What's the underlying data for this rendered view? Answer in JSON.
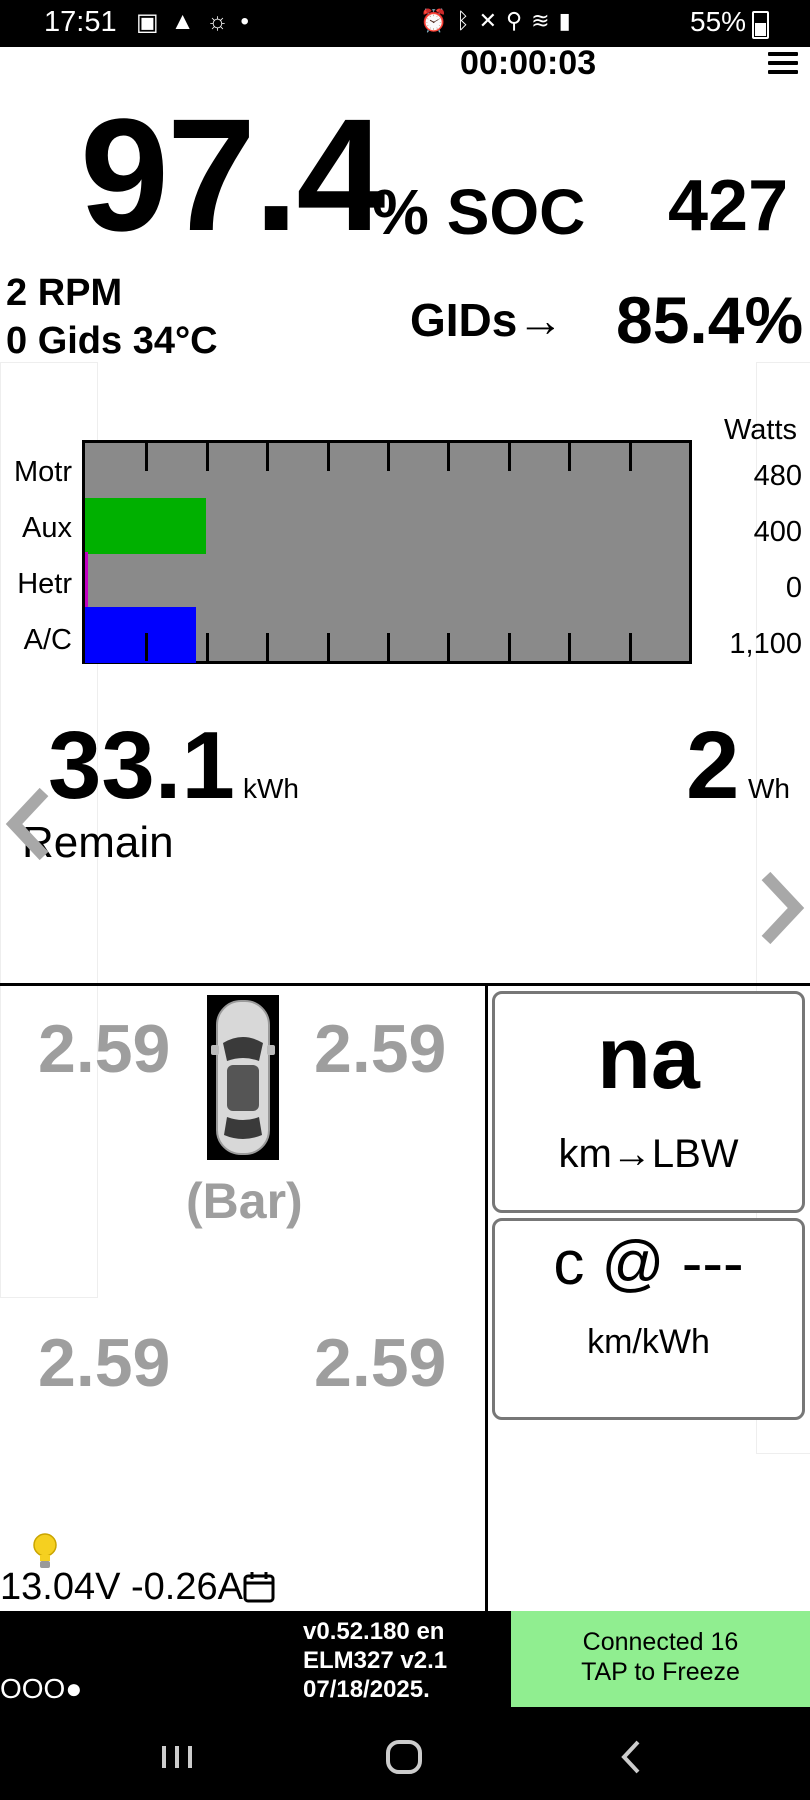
{
  "status_bar": {
    "time": "17:51",
    "battery": "55%"
  },
  "timer": "00:00:03",
  "soc": {
    "value": "97.4",
    "unit": "% SOC",
    "gids": "427"
  },
  "info": {
    "rpm": "2 RPM",
    "gids_temp": "0 Gids 34°C",
    "gids_arrow": "GIDs→",
    "gids_pct": "85.4%"
  },
  "power": {
    "header": "Watts",
    "rows": [
      {
        "label": "Motr",
        "watts": "480",
        "fraction": 0.0,
        "color": "#8a8a8a"
      },
      {
        "label": "Aux",
        "watts": "400",
        "fraction": 0.2,
        "color": "#00b000"
      },
      {
        "label": "Hetr",
        "watts": "0",
        "fraction": 0.004,
        "color": "#c000c0"
      },
      {
        "label": "A/C",
        "watts": "1,100",
        "fraction": 0.183,
        "color": "#0000ff"
      }
    ]
  },
  "energy": {
    "remain_value": "33.1",
    "remain_unit": "kWh",
    "remain_label": "Remain",
    "used_value": "2",
    "used_unit": "Wh"
  },
  "tires": {
    "front_left": "2.59",
    "front_right": "2.59",
    "rear_left": "2.59",
    "rear_right": "2.59",
    "unit": "(Bar)"
  },
  "cards": {
    "range_value": "na",
    "range_unit": "km→LBW",
    "efficiency_value": "c @ ---",
    "efficiency_unit": "km/kWh"
  },
  "battery12v": "13.04V -0.26A",
  "footer": {
    "dots": "OOO●",
    "version_line1": "v0.52.180 en",
    "version_line2": "ELM327 v2.1",
    "version_line3": "07/18/2025.",
    "connected": "Connected 16",
    "tap": "TAP to Freeze",
    "connected_color": "#90ee90"
  }
}
